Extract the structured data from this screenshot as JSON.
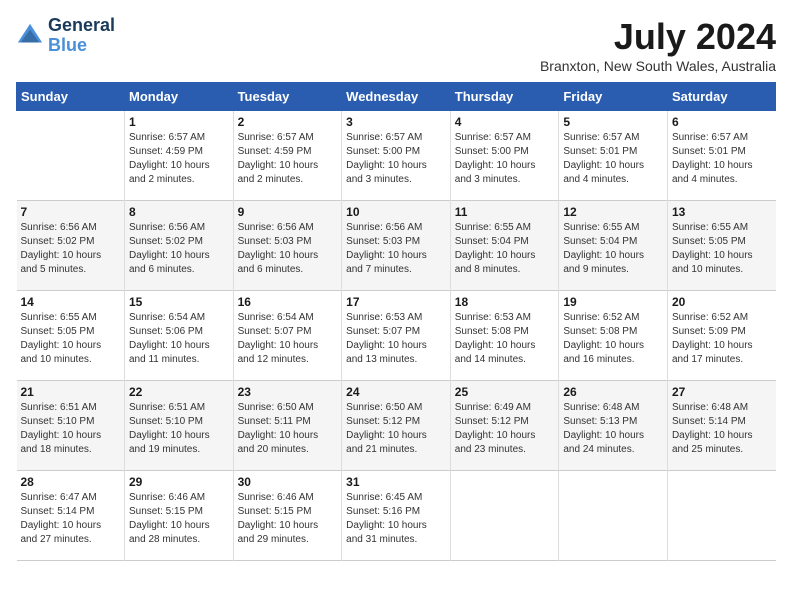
{
  "header": {
    "logo_line1": "General",
    "logo_line2": "Blue",
    "month_year": "July 2024",
    "location": "Branxton, New South Wales, Australia"
  },
  "days_of_week": [
    "Sunday",
    "Monday",
    "Tuesday",
    "Wednesday",
    "Thursday",
    "Friday",
    "Saturday"
  ],
  "weeks": [
    [
      {
        "day": "",
        "info": ""
      },
      {
        "day": "1",
        "info": "Sunrise: 6:57 AM\nSunset: 4:59 PM\nDaylight: 10 hours\nand 2 minutes."
      },
      {
        "day": "2",
        "info": "Sunrise: 6:57 AM\nSunset: 4:59 PM\nDaylight: 10 hours\nand 2 minutes."
      },
      {
        "day": "3",
        "info": "Sunrise: 6:57 AM\nSunset: 5:00 PM\nDaylight: 10 hours\nand 3 minutes."
      },
      {
        "day": "4",
        "info": "Sunrise: 6:57 AM\nSunset: 5:00 PM\nDaylight: 10 hours\nand 3 minutes."
      },
      {
        "day": "5",
        "info": "Sunrise: 6:57 AM\nSunset: 5:01 PM\nDaylight: 10 hours\nand 4 minutes."
      },
      {
        "day": "6",
        "info": "Sunrise: 6:57 AM\nSunset: 5:01 PM\nDaylight: 10 hours\nand 4 minutes."
      }
    ],
    [
      {
        "day": "7",
        "info": "Sunrise: 6:56 AM\nSunset: 5:02 PM\nDaylight: 10 hours\nand 5 minutes."
      },
      {
        "day": "8",
        "info": "Sunrise: 6:56 AM\nSunset: 5:02 PM\nDaylight: 10 hours\nand 6 minutes."
      },
      {
        "day": "9",
        "info": "Sunrise: 6:56 AM\nSunset: 5:03 PM\nDaylight: 10 hours\nand 6 minutes."
      },
      {
        "day": "10",
        "info": "Sunrise: 6:56 AM\nSunset: 5:03 PM\nDaylight: 10 hours\nand 7 minutes."
      },
      {
        "day": "11",
        "info": "Sunrise: 6:55 AM\nSunset: 5:04 PM\nDaylight: 10 hours\nand 8 minutes."
      },
      {
        "day": "12",
        "info": "Sunrise: 6:55 AM\nSunset: 5:04 PM\nDaylight: 10 hours\nand 9 minutes."
      },
      {
        "day": "13",
        "info": "Sunrise: 6:55 AM\nSunset: 5:05 PM\nDaylight: 10 hours\nand 10 minutes."
      }
    ],
    [
      {
        "day": "14",
        "info": "Sunrise: 6:55 AM\nSunset: 5:05 PM\nDaylight: 10 hours\nand 10 minutes."
      },
      {
        "day": "15",
        "info": "Sunrise: 6:54 AM\nSunset: 5:06 PM\nDaylight: 10 hours\nand 11 minutes."
      },
      {
        "day": "16",
        "info": "Sunrise: 6:54 AM\nSunset: 5:07 PM\nDaylight: 10 hours\nand 12 minutes."
      },
      {
        "day": "17",
        "info": "Sunrise: 6:53 AM\nSunset: 5:07 PM\nDaylight: 10 hours\nand 13 minutes."
      },
      {
        "day": "18",
        "info": "Sunrise: 6:53 AM\nSunset: 5:08 PM\nDaylight: 10 hours\nand 14 minutes."
      },
      {
        "day": "19",
        "info": "Sunrise: 6:52 AM\nSunset: 5:08 PM\nDaylight: 10 hours\nand 16 minutes."
      },
      {
        "day": "20",
        "info": "Sunrise: 6:52 AM\nSunset: 5:09 PM\nDaylight: 10 hours\nand 17 minutes."
      }
    ],
    [
      {
        "day": "21",
        "info": "Sunrise: 6:51 AM\nSunset: 5:10 PM\nDaylight: 10 hours\nand 18 minutes."
      },
      {
        "day": "22",
        "info": "Sunrise: 6:51 AM\nSunset: 5:10 PM\nDaylight: 10 hours\nand 19 minutes."
      },
      {
        "day": "23",
        "info": "Sunrise: 6:50 AM\nSunset: 5:11 PM\nDaylight: 10 hours\nand 20 minutes."
      },
      {
        "day": "24",
        "info": "Sunrise: 6:50 AM\nSunset: 5:12 PM\nDaylight: 10 hours\nand 21 minutes."
      },
      {
        "day": "25",
        "info": "Sunrise: 6:49 AM\nSunset: 5:12 PM\nDaylight: 10 hours\nand 23 minutes."
      },
      {
        "day": "26",
        "info": "Sunrise: 6:48 AM\nSunset: 5:13 PM\nDaylight: 10 hours\nand 24 minutes."
      },
      {
        "day": "27",
        "info": "Sunrise: 6:48 AM\nSunset: 5:14 PM\nDaylight: 10 hours\nand 25 minutes."
      }
    ],
    [
      {
        "day": "28",
        "info": "Sunrise: 6:47 AM\nSunset: 5:14 PM\nDaylight: 10 hours\nand 27 minutes."
      },
      {
        "day": "29",
        "info": "Sunrise: 6:46 AM\nSunset: 5:15 PM\nDaylight: 10 hours\nand 28 minutes."
      },
      {
        "day": "30",
        "info": "Sunrise: 6:46 AM\nSunset: 5:15 PM\nDaylight: 10 hours\nand 29 minutes."
      },
      {
        "day": "31",
        "info": "Sunrise: 6:45 AM\nSunset: 5:16 PM\nDaylight: 10 hours\nand 31 minutes."
      },
      {
        "day": "",
        "info": ""
      },
      {
        "day": "",
        "info": ""
      },
      {
        "day": "",
        "info": ""
      }
    ]
  ]
}
